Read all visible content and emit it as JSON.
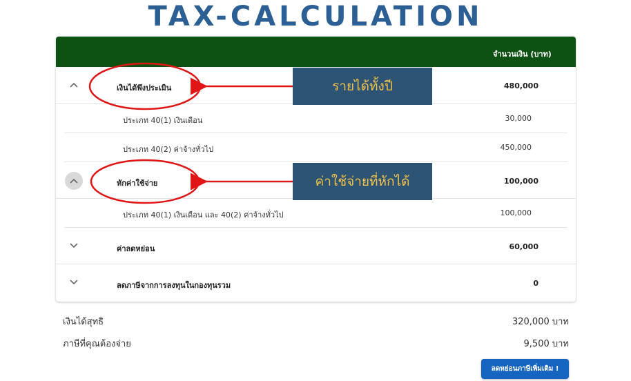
{
  "page_title": "TAX-CALCULATION",
  "table": {
    "amount_header": "จำนวนเงิน (บาท)",
    "income": {
      "label": "เงินได้พึงประเมิน",
      "value": "480,000",
      "items": [
        {
          "label": "ประเภท 40(1) เงินเดือน",
          "value": "30,000"
        },
        {
          "label": "ประเภท 40(2) ค่าจ้างทั่วไป",
          "value": "450,000"
        }
      ]
    },
    "expense": {
      "label": "หักค่าใช้จ่าย",
      "value": "100,000",
      "items": [
        {
          "label": "ประเภท 40(1) เงินเดือน และ 40(2) ค่าจ้างทั่วไป",
          "value": "100,000"
        }
      ]
    },
    "deduction": {
      "label": "ค่าลดหย่อน",
      "value": "60,000"
    },
    "fund": {
      "label": "ลดภาษีจากการลงทุนในกองทุนรวม",
      "value": "0"
    }
  },
  "callouts": {
    "income": "รายได้ทั้งปี",
    "expense": "ค่าใช้จ่ายที่หักได้"
  },
  "summary": {
    "net_income_label": "เงินได้สุทธิ",
    "net_income_value": "320,000 บาท",
    "tax_label": "ภาษีที่คุณต้องจ่าย",
    "tax_value": "9,500 บาท"
  },
  "more_button_label": "ลดหย่อนภาษีเพิ่มเติม !",
  "colors": {
    "title": "#2c5f93",
    "header_bg": "#0e5213",
    "callout_bg": "#2d5474",
    "callout_text": "#f0c24a",
    "annotation_red": "#e01515",
    "button_bg": "#1565c0"
  }
}
